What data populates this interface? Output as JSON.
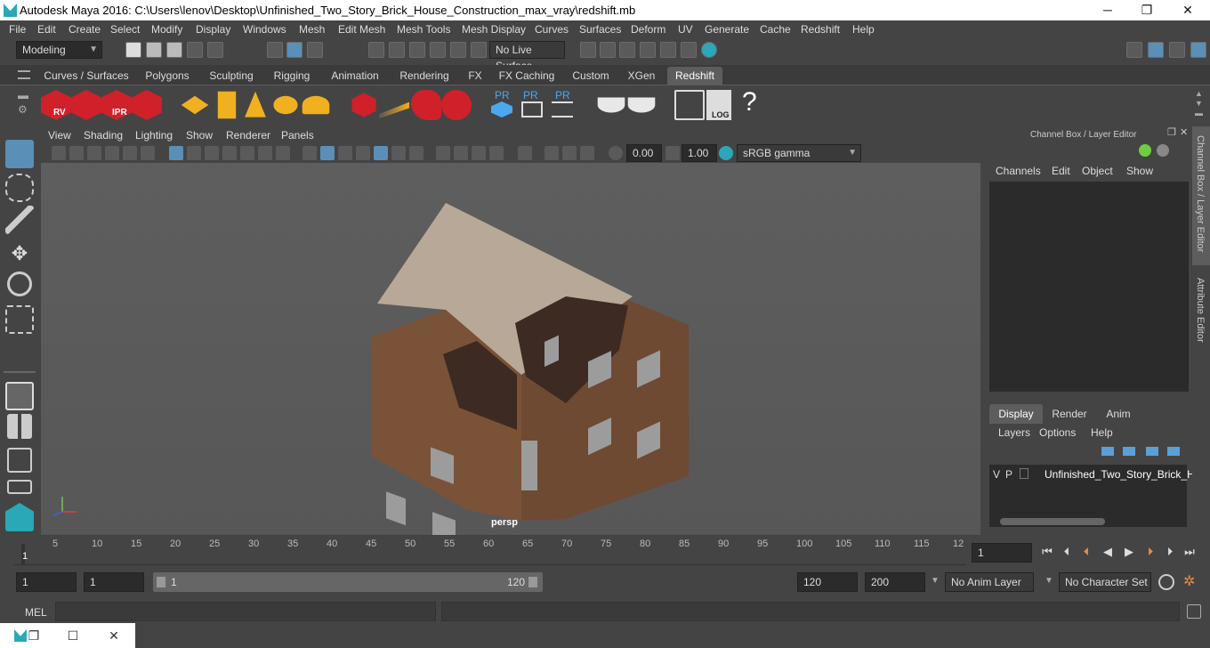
{
  "window": {
    "title": "Autodesk Maya 2016: C:\\Users\\lenov\\Desktop\\Unfinished_Two_Story_Brick_House_Construction_max_vray\\redshift.mb",
    "minimize": "─",
    "maximize": "❐",
    "close": "✕"
  },
  "menubar": [
    "File",
    "Edit",
    "Create",
    "Select",
    "Modify",
    "Display",
    "Windows",
    "Mesh",
    "Edit Mesh",
    "Mesh Tools",
    "Mesh Display",
    "Curves",
    "Surfaces",
    "Deform",
    "UV",
    "Generate",
    "Cache",
    "Redshift",
    "Help"
  ],
  "statusline": {
    "mode": "Modeling",
    "live_surface": "No Live Surface"
  },
  "shelf_tabs": [
    "Curves / Surfaces",
    "Polygons",
    "Sculpting",
    "Rigging",
    "Animation",
    "Rendering",
    "FX",
    "FX Caching",
    "Custom",
    "XGen",
    "Redshift"
  ],
  "shelf_active_tab": "Redshift",
  "shelf_labels": {
    "rv": "RV",
    "ipr": "IPR",
    "pr1": "PR",
    "pr2": "PR",
    "pr3": "PR",
    "log": "LOG",
    "help": "?"
  },
  "viewport": {
    "menu": [
      "View",
      "Shading",
      "Lighting",
      "Show",
      "Renderer",
      "Panels"
    ],
    "near_value": "0.00",
    "far_value": "1.00",
    "color_space": "sRGB gamma",
    "camera_label": "persp"
  },
  "channel_box": {
    "header": "Channel Box / Layer Editor",
    "menu": [
      "Channels",
      "Edit",
      "Object",
      "Show"
    ]
  },
  "layer_editor": {
    "tabs": [
      "Display",
      "Render",
      "Anim"
    ],
    "active_tab": "Display",
    "menu": [
      "Layers",
      "Options",
      "Help"
    ],
    "layer": {
      "v": "V",
      "p": "P",
      "name": "Unfinished_Two_Story_Brick_H"
    }
  },
  "side_tabs": [
    "Channel Box / Layer Editor",
    "Attribute Editor"
  ],
  "timeline": {
    "ticks": [
      "5",
      "10",
      "15",
      "20",
      "25",
      "30",
      "35",
      "40",
      "45",
      "50",
      "55",
      "60",
      "65",
      "70",
      "75",
      "80",
      "85",
      "90",
      "95",
      "100",
      "105",
      "110",
      "115",
      "12"
    ],
    "start_marker": "1",
    "current_frame": "1"
  },
  "range": {
    "start": "1",
    "start2": "1",
    "slider_start": "1",
    "slider_end": "120",
    "end": "120",
    "end2": "200",
    "anim_layer": "No Anim Layer",
    "char_set": "No Character Set"
  },
  "mel": {
    "label": "MEL"
  }
}
